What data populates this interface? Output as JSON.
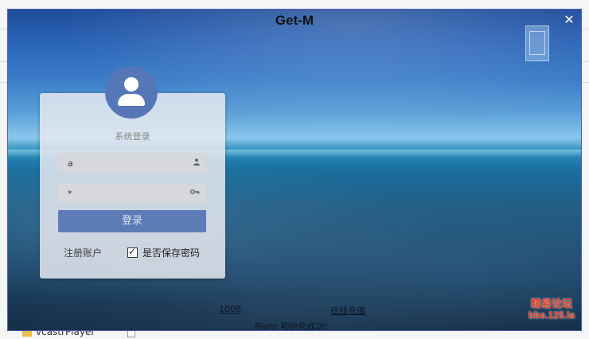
{
  "window": {
    "title": "Get-M",
    "close_glyph": "✕"
  },
  "login": {
    "title": "系统登录",
    "username_value": "a",
    "password_value": "*",
    "login_label": "登录",
    "register_label": "注册账户",
    "save_password_label": "是否保存密码"
  },
  "footer": {
    "left_link": "1008",
    "right_link": "在线充值",
    "status": "Right 初始化成功!"
  },
  "background": {
    "folder_label": "vcastrPlayer"
  },
  "watermark": {
    "top": "精易论坛",
    "bottom": "bbs.125.la"
  },
  "colors": {
    "accent": "#5d7cb7",
    "avatar": "#5577b8",
    "watermark": "#e43b20",
    "window_border": "#4d5db8"
  }
}
